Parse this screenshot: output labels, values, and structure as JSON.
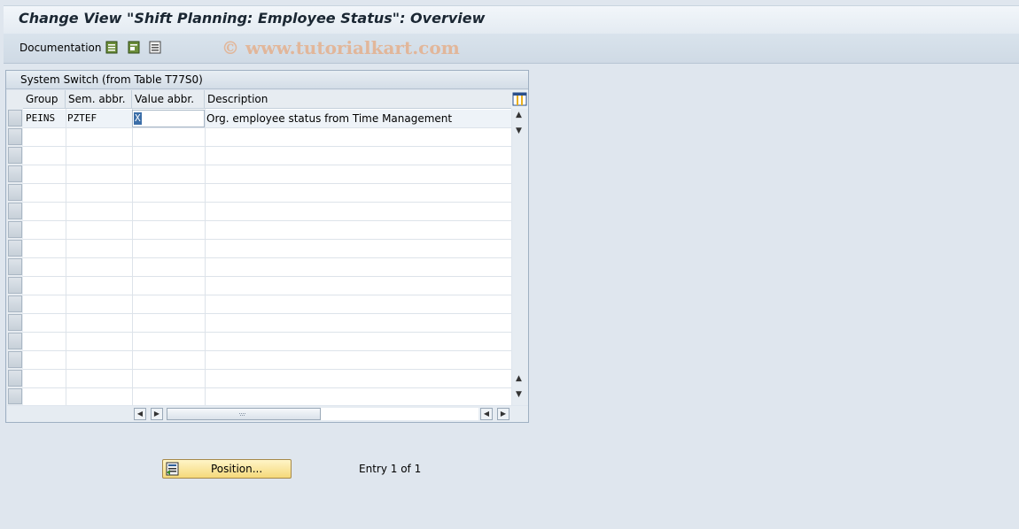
{
  "window": {
    "title": "Change View \"Shift Planning: Employee Status\": Overview"
  },
  "toolbar": {
    "documentation_label": "Documentation",
    "icons": [
      "select-all-icon",
      "select-block-icon",
      "deselect-all-icon"
    ],
    "watermark": "© www.tutorialkart.com"
  },
  "panel": {
    "title": "System Switch (from Table T77S0)",
    "columns": [
      "Group",
      "Sem. abbr.",
      "Value abbr.",
      "Description"
    ],
    "rows": [
      {
        "group": "PEINS",
        "sem_abbr": "PZTEF",
        "value_abbr": "X",
        "description": "Org. employee status from Time Management"
      }
    ],
    "empty_rows": 15
  },
  "footer": {
    "position_button_label": "Position...",
    "entry_text": "Entry 1 of 1"
  },
  "colors": {
    "background": "#dfe6ee",
    "button_yellow": "#f5d97a",
    "watermark": "#ec965a"
  }
}
